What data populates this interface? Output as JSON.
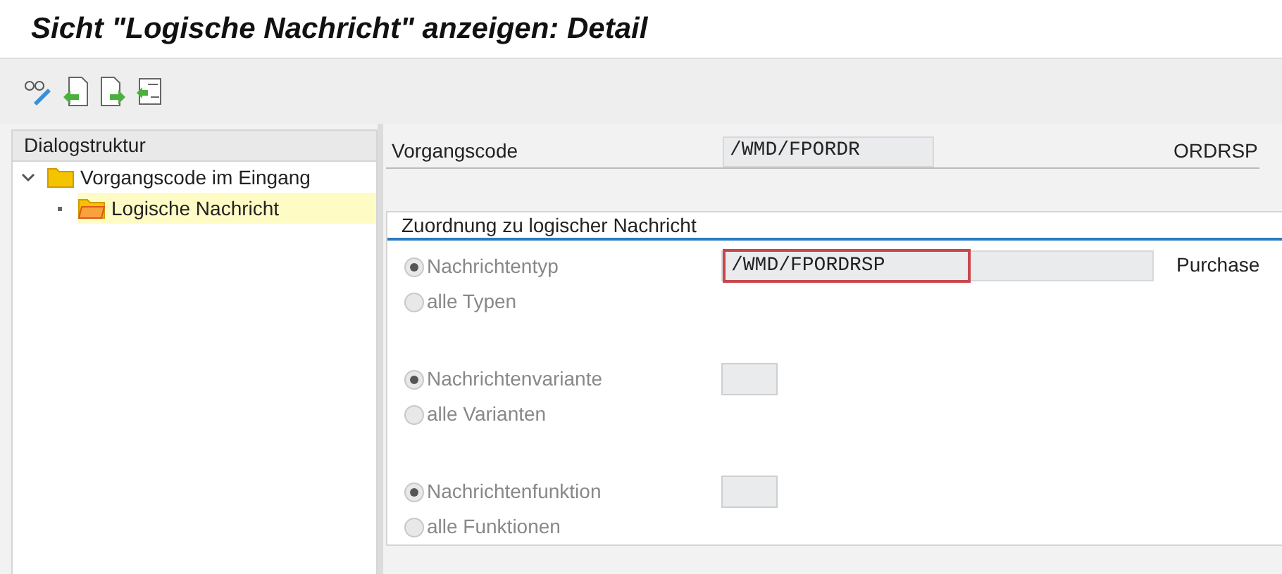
{
  "title": "Sicht \"Logische Nachricht\" anzeigen: Detail",
  "tree": {
    "header": "Dialogstruktur",
    "items": [
      {
        "label": "Vorgangscode im Eingang",
        "expanded": true,
        "selected": false,
        "children": [
          {
            "label": "Logische Nachricht",
            "selected": true
          }
        ]
      }
    ]
  },
  "header_field": {
    "label": "Vorgangscode",
    "value": "/WMD/FPORDR",
    "description": "ORDRSP"
  },
  "group": {
    "title": "Zuordnung zu logischer Nachricht",
    "sections": [
      {
        "options": [
          {
            "label": "Nachrichtentyp",
            "selected": true
          },
          {
            "label": "alle Typen",
            "selected": false
          }
        ],
        "value": "/WMD/FPORDRSP",
        "highlighted": true,
        "description": "Purchase"
      },
      {
        "options": [
          {
            "label": "Nachrichtenvariante",
            "selected": true
          },
          {
            "label": "alle Varianten",
            "selected": false
          }
        ],
        "highlighted": false
      },
      {
        "options": [
          {
            "label": "Nachrichtenfunktion",
            "selected": true
          },
          {
            "label": "alle Funktionen",
            "selected": false
          }
        ],
        "highlighted": false
      }
    ]
  }
}
